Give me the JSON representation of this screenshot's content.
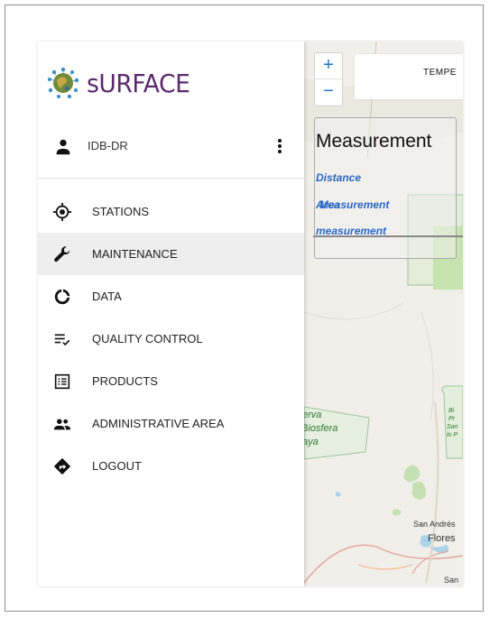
{
  "app": {
    "logo_text": "sURFACE"
  },
  "user": {
    "name": "IDB-DR"
  },
  "nav": {
    "items": [
      {
        "label": "STATIONS",
        "icon": "crosshair-icon",
        "active": false
      },
      {
        "label": "MAINTENANCE",
        "icon": "wrench-icon",
        "active": true
      },
      {
        "label": "DATA",
        "icon": "donut-chart-icon",
        "active": false
      },
      {
        "label": "QUALITY CONTROL",
        "icon": "checklist-icon",
        "active": false
      },
      {
        "label": "PRODUCTS",
        "icon": "list-box-icon",
        "active": false
      },
      {
        "label": "ADMINISTRATIVE AREA",
        "icon": "people-icon",
        "active": false
      },
      {
        "label": "LOGOUT",
        "icon": "directions-sign-icon",
        "active": false
      }
    ]
  },
  "map": {
    "zoom_in": "+",
    "zoom_out": "−",
    "layer_label": "TEMPE",
    "measure": {
      "title": "Measurement",
      "distance_link": "Distance",
      "area_link": "Area",
      "measurement_overlap": "Measurement",
      "measurement_link": "measurement"
    },
    "labels": {
      "reserva_1": "erva",
      "reserva_2": "Biosfera",
      "reserva_3": "aya",
      "park_1": "Bi",
      "park_2": "Pr",
      "park_3": "San",
      "park_4": "lo P",
      "town_1": "San Andrés",
      "town_2": "Flores",
      "town_3": "San"
    }
  },
  "colors": {
    "logo": "#5b2a6e",
    "active_bg": "#eeeeee",
    "link": "#2a68c6",
    "map_bg": "#f1efe9"
  }
}
